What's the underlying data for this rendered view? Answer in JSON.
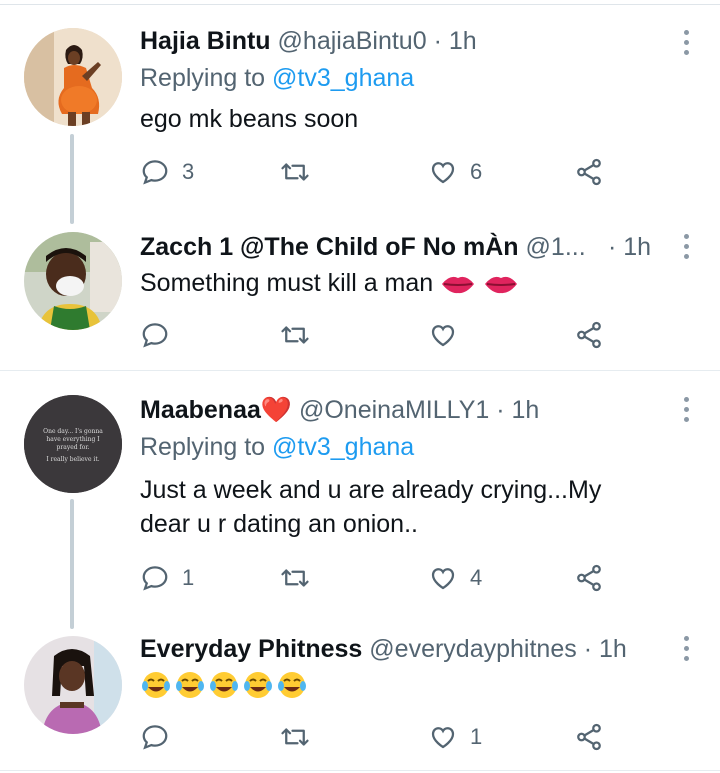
{
  "tweets": [
    {
      "name": "Hajia Bintu",
      "handle": "@hajiaBintu0",
      "dot": "·",
      "time": "1h",
      "replying_prefix": "Replying to ",
      "replying_to": "@tv3_ghana",
      "text": "ego mk beans soon",
      "replies": "3",
      "retweets": "",
      "likes": "6",
      "avatar": "woman-orange-dress-avatar"
    },
    {
      "name": "Zacch 1 @The Child oF No mÀn",
      "handle": "@1...",
      "dot": "·",
      "time": "1h",
      "text": "Something must kill a man",
      "emoji": [
        "lips-emoji",
        "lips-emoji"
      ],
      "replies": "",
      "retweets": "",
      "likes": "",
      "avatar": "boy-face-mask-avatar"
    },
    {
      "name": "Maabenaa",
      "heart": "❤️",
      "handle": "@OneinaMILLY1",
      "dot": "·",
      "time": "1h",
      "replying_prefix": "Replying to ",
      "replying_to": "@tv3_ghana",
      "text_line1": "Just a week and u are already crying...My",
      "text_line2": "dear u r dating an onion..",
      "replies": "1",
      "retweets": "",
      "likes": "4",
      "avatar": "quote-text-avatar",
      "avatar_quote": [
        "One day... I's gonna",
        "have everything I",
        "prayed for.",
        "I really believe it."
      ]
    },
    {
      "name": "Everyday Phitness",
      "handle": "@everydayphitnes",
      "dot": "·",
      "time": "1h",
      "text": "",
      "emoji": [
        "tears-of-joy-emoji",
        "tears-of-joy-emoji",
        "tears-of-joy-emoji",
        "tears-of-joy-emoji",
        "tears-of-joy-emoji"
      ],
      "replies": "",
      "retweets": "",
      "likes": "1",
      "avatar": "girl-braids-avatar"
    }
  ],
  "colors": {
    "link": "#1d9bf0",
    "muted": "#536471",
    "thread_line": "#c4cfd6",
    "divider": "#e6ecf0"
  }
}
